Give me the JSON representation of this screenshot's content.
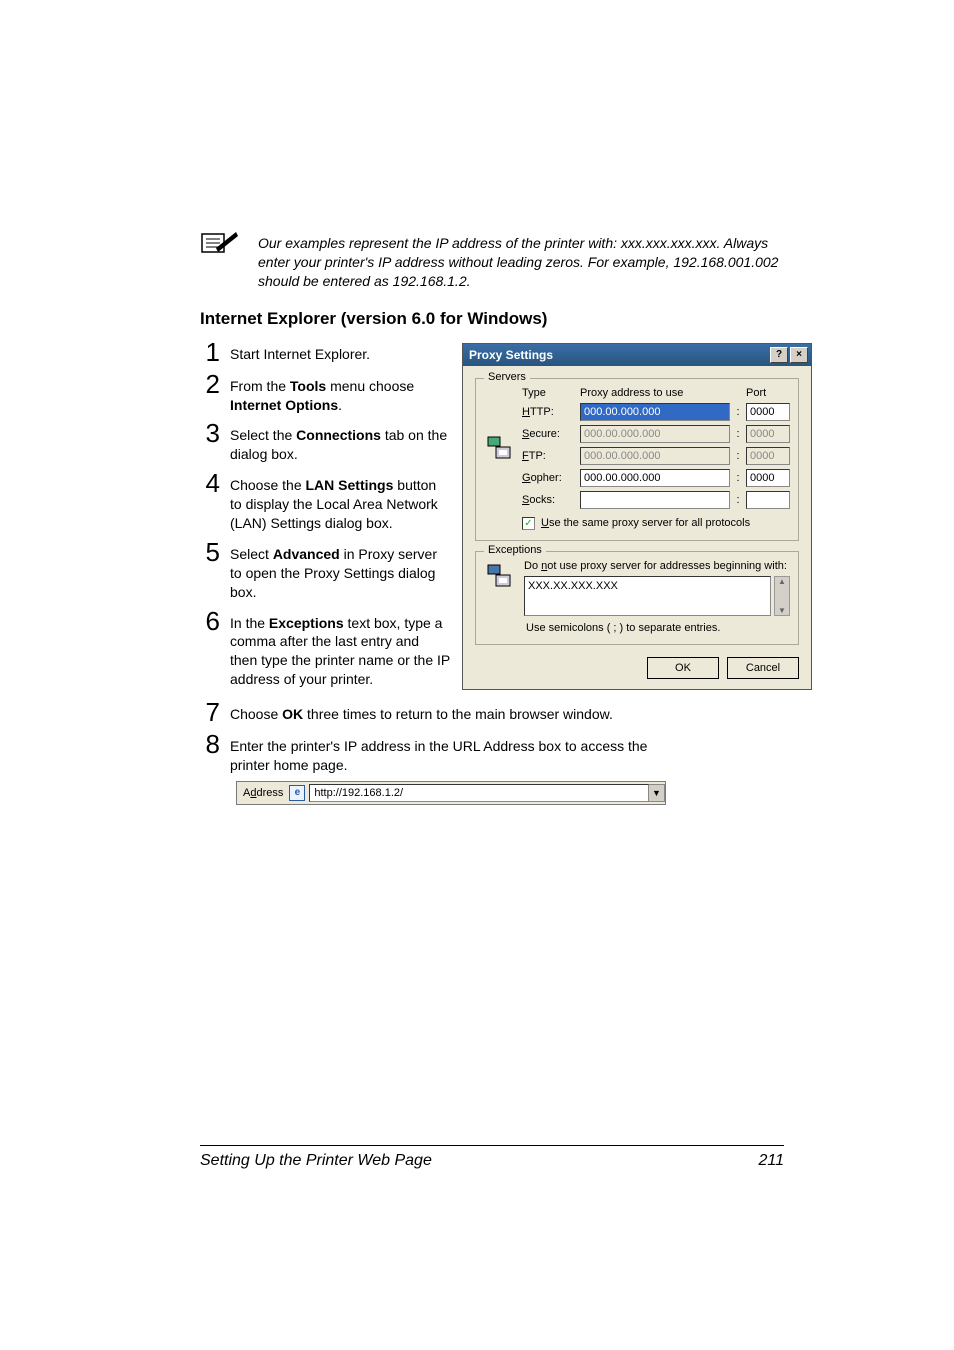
{
  "note": {
    "text": "Our examples represent the IP address of the printer with: xxx.xxx.xxx.xxx. Always enter your printer's IP address without leading zeros. For example, 192.168.001.002 should be entered as 192.168.1.2."
  },
  "section_title": "Internet Explorer (version 6.0 for Windows)",
  "steps": [
    {
      "n": "1",
      "pre": "Start Internet Explorer.",
      "bold": "",
      "post": ""
    },
    {
      "n": "2",
      "pre": "From the ",
      "bold": "Tools",
      "mid": " menu choose ",
      "bold2": "Internet Options",
      "post": "."
    },
    {
      "n": "3",
      "pre": "Select the ",
      "bold": "Connections",
      "post": " tab on the dialog box."
    },
    {
      "n": "4",
      "pre": "Choose the ",
      "bold": "LAN Settings",
      "post": " button to display the Local Area Network (LAN) Settings dialog box."
    },
    {
      "n": "5",
      "pre": "Select ",
      "bold": "Advanced",
      "post": " in Proxy server to open the Proxy Settings dialog box."
    },
    {
      "n": "6",
      "pre": "In the ",
      "bold": "Exceptions",
      "post": " text box, type a comma after the last entry and then type the printer name or the IP address of your printer."
    },
    {
      "n": "7",
      "pre": "Choose ",
      "bold": "OK",
      "post": " three times to return to the main browser window."
    },
    {
      "n": "8",
      "pre": "Enter the printer's IP address in the URL Address box to access the printer home page.",
      "bold": "",
      "post": ""
    }
  ],
  "proxy_dialog": {
    "title": "Proxy Settings",
    "servers_legend": "Servers",
    "headers": {
      "type": "Type",
      "addr": "Proxy address to use",
      "port": "Port"
    },
    "rows": [
      {
        "label": "HTTP:",
        "addr": "000.00.000.000",
        "port": "0000",
        "sel": true,
        "dis": false
      },
      {
        "label": "Secure:",
        "addr": "000.00.000.000",
        "port": "0000",
        "sel": false,
        "dis": true
      },
      {
        "label": "FTP:",
        "addr": "000.00.000.000",
        "port": "0000",
        "sel": false,
        "dis": true
      },
      {
        "label": "Gopher:",
        "addr": "000.00.000.000",
        "port": "0000",
        "sel": false,
        "dis": false
      },
      {
        "label": "Socks:",
        "addr": "",
        "port": "",
        "sel": false,
        "dis": false
      }
    ],
    "checkbox_label": "Use the same proxy server for all protocols",
    "checkbox_checked": true,
    "exceptions_legend": "Exceptions",
    "exceptions_label": "Do not use proxy server for addresses beginning with:",
    "exceptions_value": "XXX.XX.XXX.XXX",
    "exceptions_hint": "Use semicolons ( ; ) to separate entries.",
    "ok": "OK",
    "cancel": "Cancel",
    "help": "?",
    "close": "×"
  },
  "address_bar": {
    "label": "Address",
    "value": "http://192.168.1.2/"
  },
  "footer": {
    "left": "Setting Up the Printer Web Page",
    "right": "211"
  }
}
